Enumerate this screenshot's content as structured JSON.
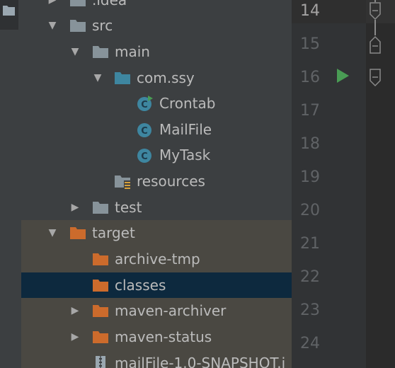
{
  "project_tree": {
    "items": [
      {
        "label": ".idea",
        "icon": "folder-icon",
        "expanded": false
      },
      {
        "label": "src",
        "icon": "folder-icon",
        "expanded": true
      },
      {
        "label": "main",
        "icon": "folder-icon",
        "expanded": true
      },
      {
        "label": "com.ssy",
        "icon": "package-folder-icon",
        "expanded": true
      },
      {
        "label": "Crontab",
        "icon": "java-class-runnable-icon"
      },
      {
        "label": "MailFile",
        "icon": "java-class-icon"
      },
      {
        "label": "MyTask",
        "icon": "java-class-icon"
      },
      {
        "label": "resources",
        "icon": "resources-folder-icon"
      },
      {
        "label": "test",
        "icon": "folder-icon",
        "expanded": false
      },
      {
        "label": "target",
        "icon": "excluded-folder-icon",
        "expanded": true
      },
      {
        "label": "archive-tmp",
        "icon": "excluded-folder-icon"
      },
      {
        "label": "classes",
        "icon": "excluded-folder-icon",
        "selected": true
      },
      {
        "label": "maven-archiver",
        "icon": "excluded-folder-icon",
        "expanded": false
      },
      {
        "label": "maven-status",
        "icon": "excluded-folder-icon",
        "expanded": false
      },
      {
        "label": "mailFile-1.0-SNAPSHOT.j",
        "icon": "jar-archive-icon"
      }
    ]
  },
  "gutter": {
    "line_numbers": [
      "14",
      "15",
      "16",
      "17",
      "18",
      "19",
      "20",
      "21",
      "22",
      "23",
      "24"
    ],
    "current_line": "14",
    "run_icon_line": "16"
  },
  "colors": {
    "tree_background": "#3c3f41",
    "target_band": "#4a4842",
    "selection": "#0d293e",
    "folder": "#87939a",
    "package_folder": "#3e86a0",
    "excluded_folder": "#cc6b2c",
    "class_icon": "#3e86a0",
    "run_arrow": "#499c54",
    "line_number": "#606366"
  }
}
